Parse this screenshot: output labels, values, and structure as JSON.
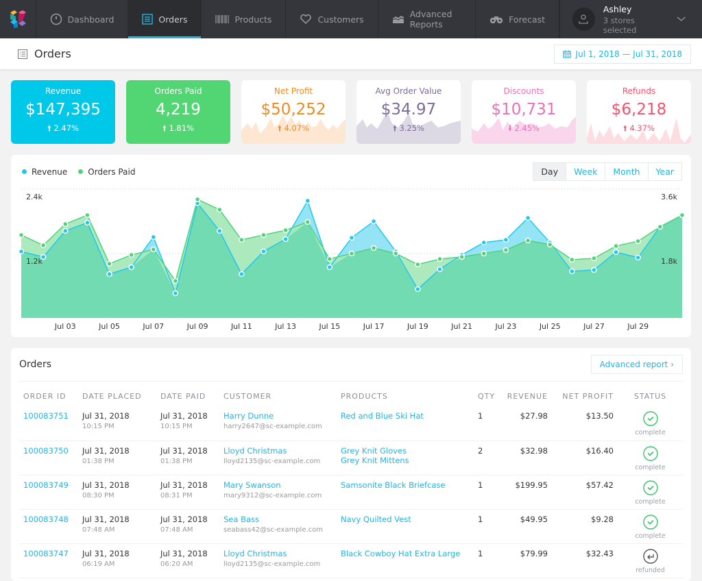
{
  "nav": {
    "items": [
      {
        "label": "Dashboard",
        "icon": "gauge-icon",
        "active": false
      },
      {
        "label": "Orders",
        "icon": "list-icon",
        "active": true
      },
      {
        "label": "Products",
        "icon": "barcode-icon",
        "active": false
      },
      {
        "label": "Customers",
        "icon": "heart-icon",
        "active": false
      },
      {
        "label": "Advanced Reports",
        "icon": "area-chart-icon",
        "active": false
      },
      {
        "label": "Forecast",
        "icon": "binoculars-icon",
        "active": false
      }
    ],
    "user": {
      "name": "Ashley",
      "subtitle": "3 stores selected"
    }
  },
  "page": {
    "title": "Orders",
    "date_range": "Jul 1, 2018 — Jul 31, 2018"
  },
  "kpis": [
    {
      "label": "Revenue",
      "value": "$147,395",
      "change": "2.47%",
      "direction": "up",
      "color": "#00c8e8",
      "solid": true
    },
    {
      "label": "Orders Paid",
      "value": "4,219",
      "change": "1.81%",
      "direction": "up",
      "color": "#52d674",
      "solid": true
    },
    {
      "label": "Net Profit",
      "value": "$50,252",
      "change": "4.07%",
      "direction": "up",
      "color": "#f08a1c",
      "fill": "#fde6d2",
      "solid": false
    },
    {
      "label": "Avg Order Value",
      "value": "$34.97",
      "change": "3.25%",
      "direction": "up",
      "color": "#7b6c9a",
      "fill": "#dcd8e4",
      "solid": false
    },
    {
      "label": "Discounts",
      "value": "$10,731",
      "change": "2.45%",
      "direction": "down",
      "color": "#ec6fb8",
      "fill": "#fad6ec",
      "solid": false
    },
    {
      "label": "Refunds",
      "value": "$6,218",
      "change": "4.37%",
      "direction": "up",
      "color": "#f4516c",
      "fill": "#fddde2",
      "solid": false
    }
  ],
  "chart_data": {
    "type": "area",
    "title": "",
    "legend_position": "top-left",
    "x": [
      "Jul 01",
      "Jul 02",
      "Jul 03",
      "Jul 04",
      "Jul 05",
      "Jul 06",
      "Jul 07",
      "Jul 08",
      "Jul 09",
      "Jul 10",
      "Jul 11",
      "Jul 12",
      "Jul 13",
      "Jul 14",
      "Jul 15",
      "Jul 16",
      "Jul 17",
      "Jul 18",
      "Jul 19",
      "Jul 20",
      "Jul 21",
      "Jul 22",
      "Jul 23",
      "Jul 24",
      "Jul 25",
      "Jul 26",
      "Jul 27",
      "Jul 28",
      "Jul 29",
      "Jul 30",
      "Jul 31"
    ],
    "x_tick_labels": [
      "Jul 03",
      "Jul 05",
      "Jul 07",
      "Jul 09",
      "Jul 11",
      "Jul 13",
      "Jul 15",
      "Jul 17",
      "Jul 19",
      "Jul 21",
      "Jul 23",
      "Jul 25",
      "Jul 27",
      "Jul 29"
    ],
    "left_axis": {
      "ticks": [
        "1.2k",
        "2.4k"
      ],
      "range": [
        0,
        2400
      ]
    },
    "right_axis": {
      "ticks": [
        "1.8k",
        "3.6k"
      ],
      "range": [
        0,
        3600
      ]
    },
    "grid": true,
    "series": [
      {
        "name": "Revenue",
        "axis": "right",
        "color": "#1fc8ef",
        "values": [
          1857,
          1703,
          2431,
          2661,
          1225,
          1417,
          2259,
          689,
          3207,
          2431,
          1225,
          1857,
          2202,
          3274,
          1417,
          2240,
          2700,
          1857,
          804,
          1359,
          1761,
          2106,
          2182,
          2795,
          2106,
          1302,
          1340,
          1838,
          1685,
          2547,
          2872
        ]
      },
      {
        "name": "Orders Paid",
        "axis": "left",
        "color": "#4fd27a",
        "values": [
          1545,
          1353,
          1749,
          1915,
          1009,
          1174,
          1276,
          689,
          2209,
          2017,
          1455,
          1545,
          1634,
          1787,
          1098,
          1200,
          1302,
          1200,
          996,
          1098,
          1136,
          1200,
          1264,
          1442,
          1366,
          1085,
          1111,
          1340,
          1430,
          1698,
          1915
        ]
      }
    ]
  },
  "chart_controls": {
    "ranges": [
      "Day",
      "Week",
      "Month",
      "Year"
    ],
    "selected": "Day"
  },
  "orders": {
    "title": "Orders",
    "advanced_link": "Advanced report ›",
    "columns": [
      "ORDER ID",
      "DATE PLACED",
      "DATE PAID",
      "CUSTOMER",
      "PRODUCTS",
      "QTY",
      "REVENUE",
      "NET PROFIT",
      "STATUS"
    ],
    "rows": [
      {
        "id": "100083751",
        "placed_date": "Jul 31, 2018",
        "placed_time": "10:15 PM",
        "paid_date": "Jul 31, 2018",
        "paid_time": "10:15 PM",
        "customer": "Harry Dunne",
        "email": "harry2647@sc-example.com",
        "products": [
          "Red and Blue Ski Hat"
        ],
        "qty": "1",
        "revenue": "$27.98",
        "profit": "$13.50",
        "status": "complete"
      },
      {
        "id": "100083750",
        "placed_date": "Jul 31, 2018",
        "placed_time": "01:38 PM",
        "paid_date": "Jul 31, 2018",
        "paid_time": "01:38 PM",
        "customer": "Lloyd Christmas",
        "email": "lloyd2135@sc-example.com",
        "products": [
          "Grey Knit Gloves",
          "Grey Knit Mittens"
        ],
        "qty": "2",
        "revenue": "$32.98",
        "profit": "$16.40",
        "status": "complete"
      },
      {
        "id": "100083749",
        "placed_date": "Jul 31, 2018",
        "placed_time": "08:30 PM",
        "paid_date": "Jul 31, 2018",
        "paid_time": "08:31 PM",
        "customer": "Mary Swanson",
        "email": "mary9312@sc-example.com",
        "products": [
          "Samsonite Black Briefcase"
        ],
        "qty": "1",
        "revenue": "$199.95",
        "profit": "$57.42",
        "status": "complete"
      },
      {
        "id": "100083748",
        "placed_date": "Jul 31, 2018",
        "placed_time": "07:48 AM",
        "paid_date": "Jul 31, 2018",
        "paid_time": "07:48 AM",
        "customer": "Sea Bass",
        "email": "seabass42@sc-example.com",
        "products": [
          "Navy Quilted Vest"
        ],
        "qty": "1",
        "revenue": "$49.95",
        "profit": "$9.28",
        "status": "complete"
      },
      {
        "id": "100083747",
        "placed_date": "Jul 31, 2018",
        "placed_time": "06:19 AM",
        "paid_date": "Jul 31, 2018",
        "paid_time": "06:20 AM",
        "customer": "Lloyd Christmas",
        "email": "lloyd2135@sc-example.com",
        "products": [
          "Black Cowboy Hat Extra Large"
        ],
        "qty": "1",
        "revenue": "$79.99",
        "profit": "$32.43",
        "status": "refunded"
      }
    ]
  }
}
